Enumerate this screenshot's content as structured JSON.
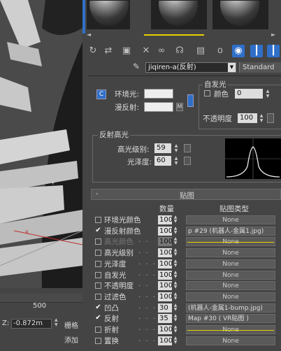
{
  "viewport": {
    "ruler_value": "500",
    "z_label": "Z:",
    "z_value": "-0.872m",
    "grid_label": "栅格",
    "add_label": "添加"
  },
  "toolbar": {
    "material_name": "jiqiren-a(反射)",
    "material_type": "Standard"
  },
  "basic": {
    "ambient_label": "环境光:",
    "diffuse_label": "漫反射:",
    "m_label": "M",
    "c_label": "C",
    "self_illum_title": "自发光",
    "color_label": "颜色",
    "color_value": "0",
    "opacity_label": "不透明度",
    "opacity_value": "100"
  },
  "specular": {
    "title": "反射高光",
    "level_label": "高光级别:",
    "level_value": "59",
    "gloss_label": "光泽度:",
    "gloss_value": "60"
  },
  "maps": {
    "rollout_toggle": "-",
    "rollout_title": "贴图",
    "col_amount": "数量",
    "col_type": "贴图类型",
    "rows": [
      {
        "label": "环境光颜色",
        "amount": "100",
        "map": "None",
        "checked": false,
        "dim": false,
        "style": "none"
      },
      {
        "label": "漫反射颜色",
        "amount": "100",
        "map": "p #29 (机器人-金属1.jpg)",
        "checked": true,
        "dim": false,
        "style": "map"
      },
      {
        "label": "高光颜色",
        "amount": "100",
        "map": "None",
        "checked": false,
        "dim": true,
        "style": "none"
      },
      {
        "label": "高光级别",
        "amount": "100",
        "map": "None",
        "checked": false,
        "dim": false,
        "style": "none"
      },
      {
        "label": "光泽度",
        "amount": "100",
        "map": "None",
        "checked": false,
        "dim": false,
        "style": "none"
      },
      {
        "label": "自发光",
        "amount": "100",
        "map": "None",
        "checked": false,
        "dim": false,
        "style": "none"
      },
      {
        "label": "不透明度",
        "amount": "100",
        "map": "None",
        "checked": false,
        "dim": false,
        "style": "none"
      },
      {
        "label": "过滤色",
        "amount": "100",
        "map": "None",
        "checked": false,
        "dim": false,
        "style": "none"
      },
      {
        "label": "凹凸",
        "amount": "30",
        "map": "(机器人-金属1-bump.jpg)",
        "checked": true,
        "dim": false,
        "style": "map"
      },
      {
        "label": "反射",
        "amount": "35",
        "map": "Map #30  ( VR贴图 )",
        "checked": true,
        "dim": false,
        "style": "map"
      },
      {
        "label": "折射",
        "amount": "100",
        "map": "None",
        "checked": false,
        "dim": false,
        "style": "none"
      },
      {
        "label": "置换",
        "amount": "100",
        "map": "None",
        "checked": false,
        "dim": false,
        "style": "none"
      }
    ]
  },
  "colors": {
    "accent_blue": "#2f6fc8",
    "panel_bg": "#444444",
    "yellow_line": "#e8d000"
  }
}
